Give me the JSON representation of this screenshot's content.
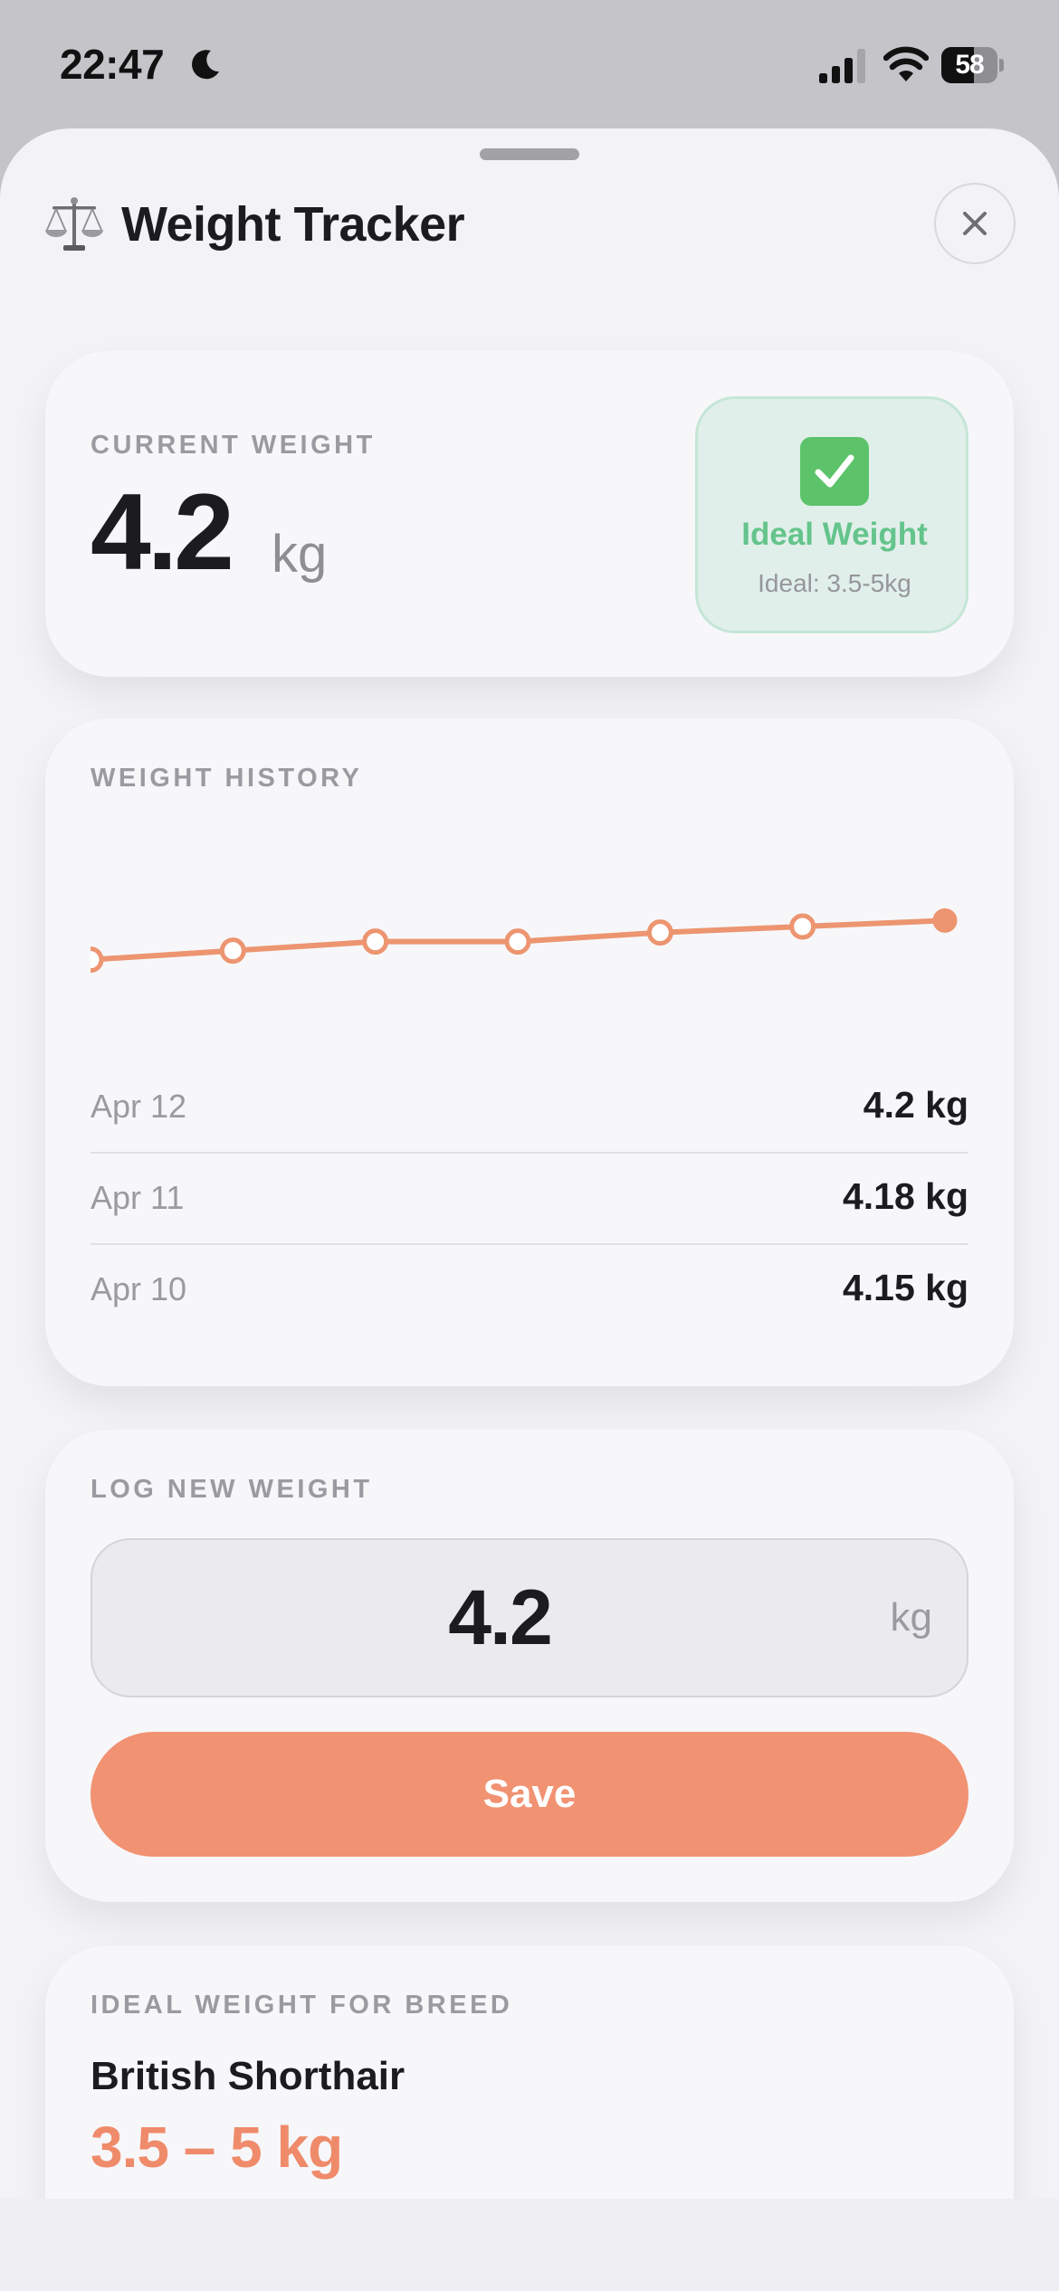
{
  "status_bar": {
    "time": "22:47",
    "battery": "58",
    "battery_level": 0.58
  },
  "header": {
    "title": "Weight Tracker",
    "icon": "scales-icon",
    "close_icon": "close-icon"
  },
  "current_weight": {
    "label": "CURRENT WEIGHT",
    "value": "4.2",
    "unit": "kg",
    "status": {
      "icon": "check-icon",
      "title": "Ideal Weight",
      "subtitle": "Ideal: 3.5-5kg"
    }
  },
  "weight_history": {
    "label": "WEIGHT HISTORY",
    "entries": [
      {
        "date": "Apr 12",
        "value": "4.2 kg"
      },
      {
        "date": "Apr 11",
        "value": "4.18 kg"
      },
      {
        "date": "Apr 10",
        "value": "4.15 kg"
      }
    ]
  },
  "chart_data": {
    "type": "line",
    "series": [
      {
        "values": [
          4.05,
          4.08,
          4.11,
          4.11,
          4.14,
          4.16,
          4.18
        ]
      }
    ],
    "ylim": [
      3.8,
      4.4
    ],
    "grid": false,
    "color": "#ec9570"
  },
  "log_weight": {
    "label": "LOG NEW WEIGHT",
    "input_value": "4.2",
    "unit": "kg",
    "save_label": "Save"
  },
  "breed": {
    "label": "IDEAL WEIGHT FOR BREED",
    "name": "British Shorthair",
    "range": "3.5 – 5 kg"
  },
  "colors": {
    "accent": "#f19272",
    "success": "#64c48b"
  }
}
